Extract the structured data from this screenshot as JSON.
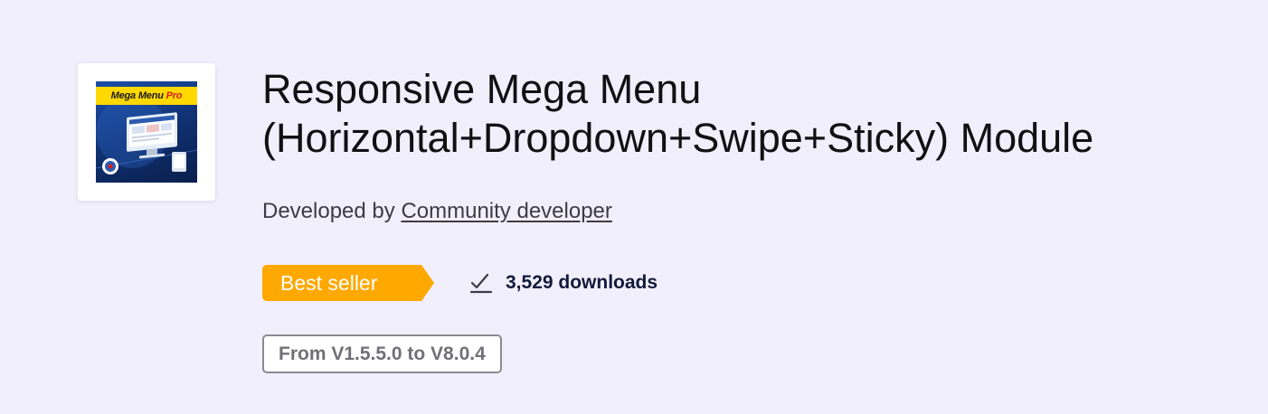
{
  "module": {
    "thumbnail": {
      "banner_text": "Mega Menu",
      "banner_accent": "Pro",
      "banner_color": "#ffd800",
      "accent_color": "#d62020"
    },
    "title_line1": "Responsive Mega Menu",
    "title_line2": "(Horizontal+Dropdown+Swipe+Sticky) Module",
    "developer_prefix": "Developed by",
    "developer_link": "Community developer",
    "badge_label": "Best seller",
    "badge_color": "#ffa800",
    "downloads_icon": "download-check-icon",
    "downloads_label": "3,529 downloads",
    "version_label": "From V1.5.5.0 to V8.0.4"
  },
  "colors": {
    "background": "#f2effd",
    "title_text": "#111114",
    "downloads_text": "#111a3a"
  }
}
